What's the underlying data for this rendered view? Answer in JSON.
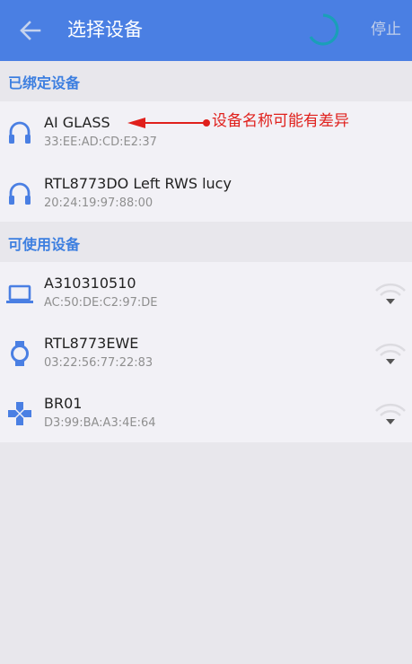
{
  "appbar": {
    "title": "选择设备",
    "stop_label": "停止",
    "back_icon": "arrow-left-icon",
    "loading_icon": "progress-spinner-icon",
    "color": "#4a7fe3"
  },
  "bonded": {
    "header": "已绑定设备",
    "devices": [
      {
        "name": "AI GLASS",
        "mac": "33:EE:AD:CD:E2:37",
        "icon": "headphones-icon"
      },
      {
        "name": "RTL8773DO Left RWS lucy",
        "mac": "20:24:19:97:88:00",
        "icon": "headphones-icon"
      }
    ]
  },
  "available": {
    "header": "可使用设备",
    "devices": [
      {
        "name": "A310310510",
        "mac": "AC:50:DE:C2:97:DE",
        "icon": "laptop-icon",
        "signal_icon": "wifi-signal-icon"
      },
      {
        "name": "RTL8773EWE",
        "mac": "03:22:56:77:22:83",
        "icon": "watch-icon",
        "signal_icon": "wifi-signal-icon"
      },
      {
        "name": "BR01",
        "mac": "D3:99:BA:A3:4E:64",
        "icon": "gamepad-icon",
        "signal_icon": "wifi-signal-icon"
      }
    ]
  },
  "annotation": {
    "text": "设备名称可能有差异",
    "color": "#e0201c"
  },
  "colors": {
    "accent": "#3d7fe0",
    "background": "#e8e7ec",
    "panel": "#f2f1f6"
  }
}
